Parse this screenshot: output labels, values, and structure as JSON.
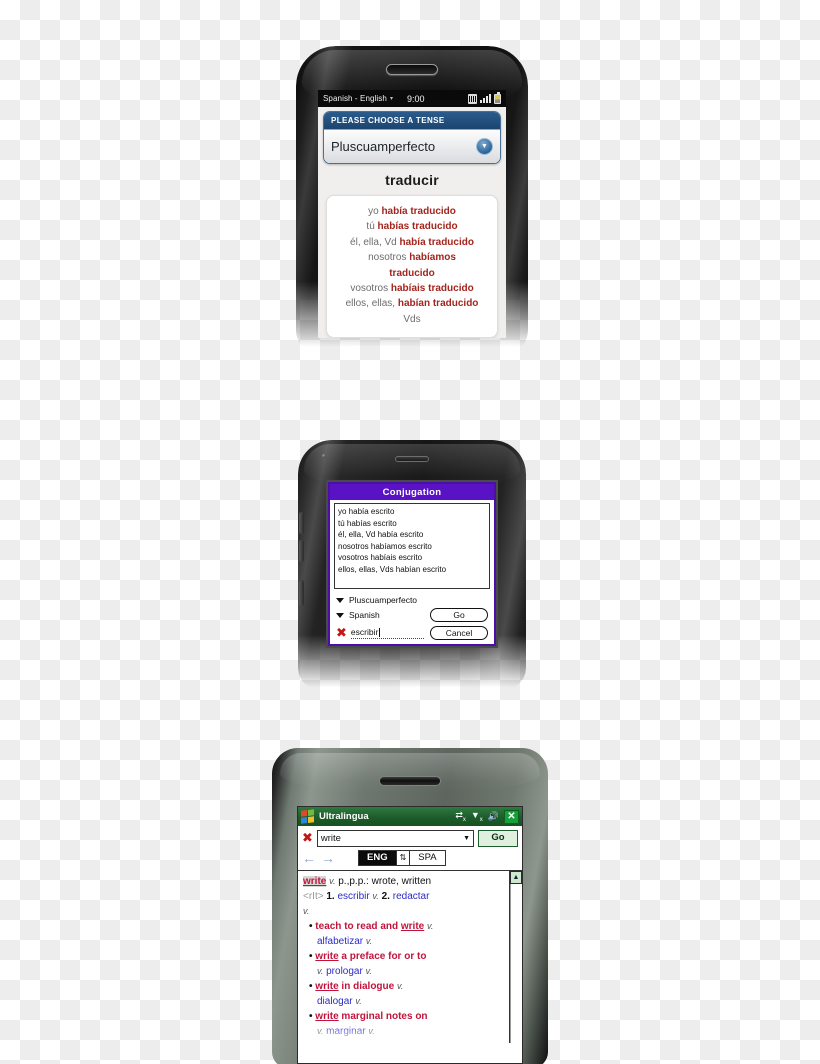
{
  "device1": {
    "platform_name": "webos-phone",
    "status_bar": {
      "language_pair": "Spanish - English",
      "caret": "▾",
      "time": "9:00"
    },
    "tense_panel": {
      "header": "PLEASE CHOOSE A TENSE",
      "selected_tense": "Pluscuamperfecto",
      "chevron": "▼"
    },
    "verb": "traducir",
    "conjugation": [
      {
        "pronoun": "yo ",
        "form": "había traducido"
      },
      {
        "pronoun": "tú ",
        "form": "habías traducido"
      },
      {
        "pronoun": "él, ella, Vd ",
        "form": "había traducido"
      },
      {
        "pronoun": "nosotros ",
        "form": "habíamos"
      },
      {
        "pronoun": "",
        "form": "traducido"
      },
      {
        "pronoun": "vosotros ",
        "form": "habíais traducido"
      },
      {
        "pronoun": "ellos, ellas, ",
        "form": "habían traducido"
      },
      {
        "pronoun": "Vds",
        "form": ""
      }
    ]
  },
  "device2": {
    "platform_name": "palm-os-phone",
    "dialog_title": "Conjugation",
    "conjugation": [
      "yo había escrito",
      "tú habías escrito",
      "él, ella, Vd había escrito",
      "nosotros habíamos escrito",
      "vosotros habíais escrito",
      "ellos, ellas, Vds habían escrito"
    ],
    "tense_option": "Pluscuamperfecto",
    "language_option": "Spanish",
    "go_button": "Go",
    "cancel_button": "Cancel",
    "search_value": "escribir",
    "clear_icon": "✖"
  },
  "device3": {
    "platform_name": "windows-mobile-phone",
    "title_bar": {
      "app_title": "Ultralingua",
      "close_label": "✕"
    },
    "search": {
      "value": "write",
      "dropdown_arrow": "▼",
      "go_label": "Go",
      "clear_icon": "✖"
    },
    "nav": {
      "back_arrow": "←",
      "forward_arrow": "→"
    },
    "language_toggle": {
      "source": "ENG",
      "swap": "⇅",
      "target": "SPA"
    },
    "scrollbar": {
      "up_arrow": "▲"
    },
    "entries": [
      {
        "headword": "write",
        "pos": "v.",
        "extra": "p.,p.p.: wrote, written"
      },
      {
        "tag": "<rIt>",
        "n1": "1.",
        "t1": "escribir",
        "p1": "v.",
        "n2": "2.",
        "t2": "redactar"
      },
      {
        "cont_pos": "v."
      },
      {
        "bullet": "•",
        "pre": "teach to read and",
        "headword": "write",
        "pos": "v."
      },
      {
        "translation": "alfabetizar",
        "pos": "v."
      },
      {
        "bullet": "•",
        "headword": "write",
        "post": "a preface for or to"
      },
      {
        "pos": "v.",
        "translation": "prologar",
        "pos2": "v."
      },
      {
        "bullet": "•",
        "headword": "write",
        "post": "in dialogue",
        "pos": "v."
      },
      {
        "translation": "dialogar",
        "pos": "v."
      },
      {
        "bullet": "•",
        "headword": "write",
        "post": "marginal notes on"
      },
      {
        "pos": "v.",
        "translation": "marginar",
        "pos2": "v."
      }
    ]
  }
}
